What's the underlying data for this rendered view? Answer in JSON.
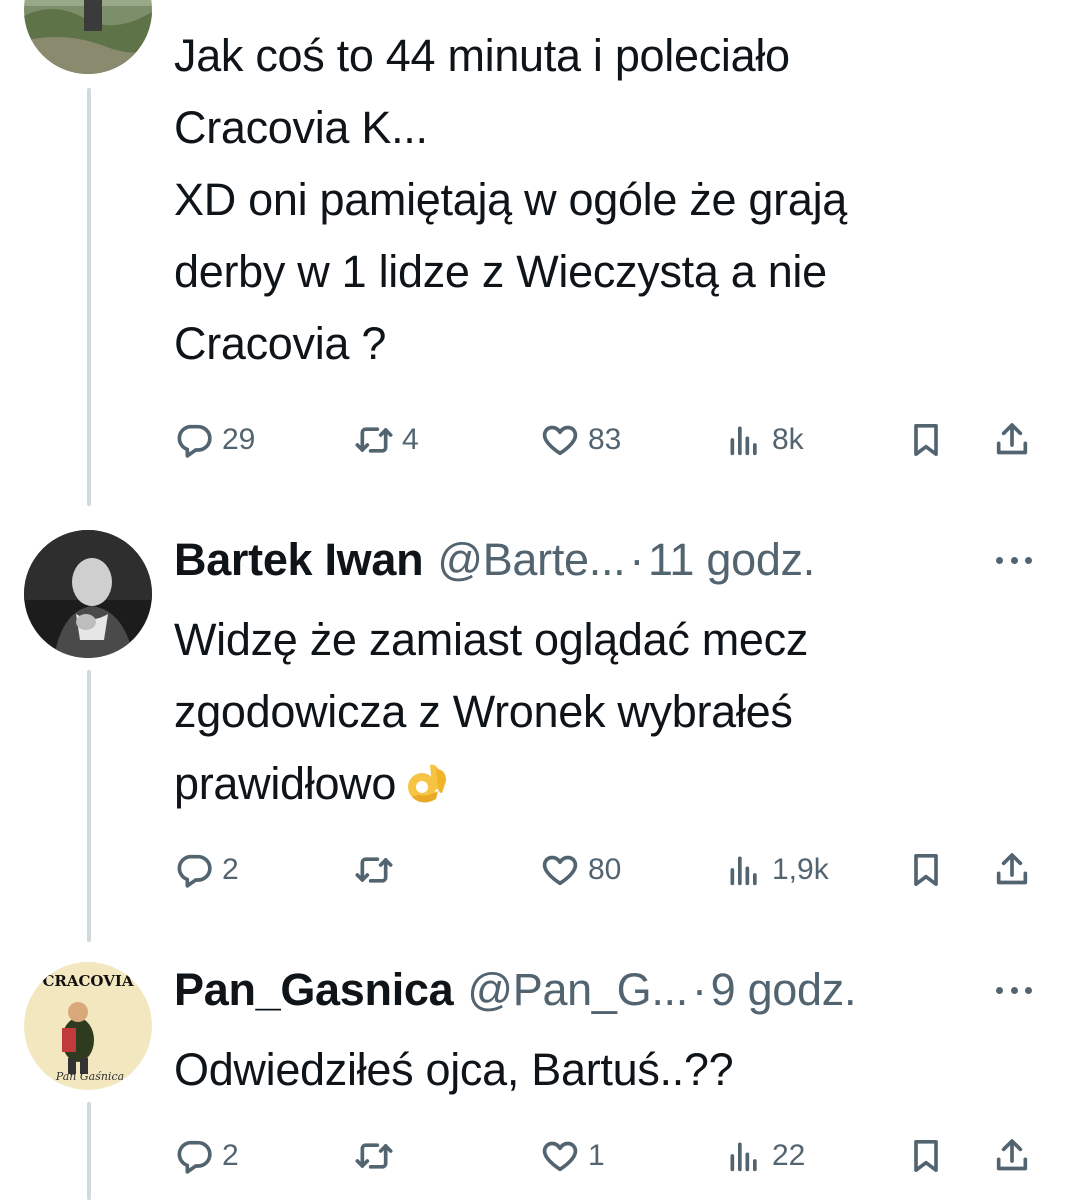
{
  "tweets": [
    {
      "avatar": "landscape-photo-avatar",
      "text_lines": [
        "Jak coś to 44 minuta i poleciało",
        "Cracovia K...",
        "XD oni pamiętają w ogóle że grają",
        "derby w 1 lidze z Wieczystą a nie",
        "Cracovia ?"
      ],
      "stats": {
        "replies": "29",
        "retweets": "4",
        "likes": "83",
        "views": "8k"
      }
    },
    {
      "avatar": "black-white-portrait-avatar",
      "name": "Bartek Iwan",
      "handle": "@Barte...",
      "separator": "·",
      "time": "11 godz.",
      "text_lines": [
        "Widzę że zamiast oglądać mecz",
        "zgodowicza z Wronek wybrałeś",
        "prawidłowo"
      ],
      "emoji": "ok-hand-emoji",
      "stats": {
        "replies": "2",
        "retweets": "",
        "likes": "80",
        "views": "1,9k"
      }
    },
    {
      "avatar": "cracovia-cartoon-avatar",
      "avatar_text": "CRACOVIA",
      "avatar_caption": "Pan Gaśnica",
      "name": "Pan_Gasnica",
      "handle": "@Pan_G...",
      "separator": "·",
      "time": "9 godz.",
      "text_lines": [
        "Odwiedziłeś ojca, Bartuś..??"
      ],
      "stats": {
        "replies": "2",
        "retweets": "",
        "likes": "1",
        "views": "22"
      }
    }
  ],
  "icons": {
    "reply": "reply-icon",
    "retweet": "retweet-icon",
    "like": "like-icon",
    "views": "views-icon",
    "bookmark": "bookmark-icon",
    "share": "share-icon",
    "more": "more-icon"
  },
  "colors": {
    "text": "#0f1419",
    "secondary": "#536471",
    "thread_line": "#cfd9de"
  }
}
